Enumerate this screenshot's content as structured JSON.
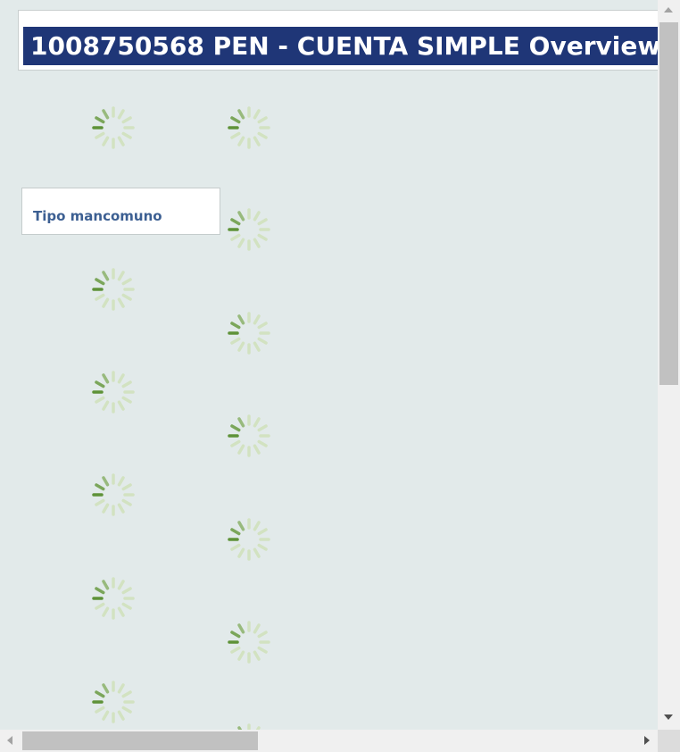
{
  "header": {
    "title": "1008750568 PEN - CUENTA SIMPLE Overview"
  },
  "field_label": {
    "text": "Tipo mancomuno"
  },
  "spinner": {
    "icon": "loading-spinner-icon",
    "dark_color": "#5e9238",
    "light_color": "#d2e2c1"
  },
  "colors": {
    "title_bar": "#1f3677",
    "background": "#e2eaea",
    "label_text": "#3c5f92"
  },
  "scrollbars": {
    "vertical": "visible",
    "horizontal": "visible"
  }
}
